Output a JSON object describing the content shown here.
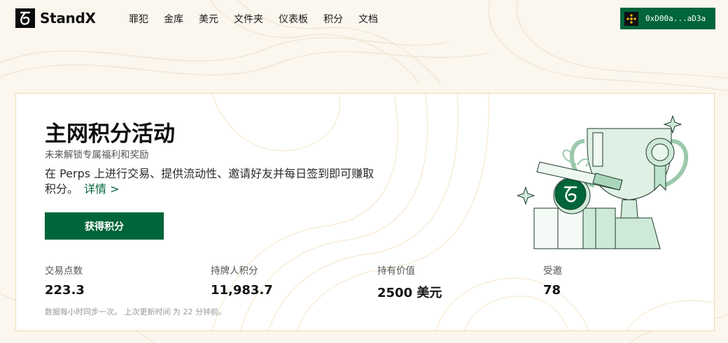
{
  "header": {
    "brand": "StandX",
    "nav": [
      "罪犯",
      "金库",
      "美元",
      "文件夹",
      "仪表板",
      "积分",
      "文档"
    ],
    "wallet_address": "0xD00a...aD3a"
  },
  "main": {
    "title": "主网积分活动",
    "subtitle": "未来解锁专属福利和奖励",
    "description": "在 Perps 上进行交易、提供流动性、邀请好友并每日签到即可赚取积分。",
    "details_link": "详情 >",
    "cta_label": "获得积分",
    "stats": [
      {
        "label": "交易点数",
        "value": "223.3"
      },
      {
        "label": "持牌人积分",
        "value": "11,983.7"
      },
      {
        "label": "持有价值",
        "value": "2500 美元"
      },
      {
        "label": "受邀",
        "value": "78"
      }
    ],
    "footnote": "数据每小时同步一次。 上次更新时间 为 22 分钟前。"
  },
  "colors": {
    "accent": "#00653a",
    "background": "#fbf7ee",
    "card_border": "#f0d8b6",
    "trophy_tint": "#cfe9d8"
  },
  "icons": {
    "logo": "standx-logo-icon",
    "wallet": "binance-icon",
    "trophy": "trophy-illustration"
  }
}
